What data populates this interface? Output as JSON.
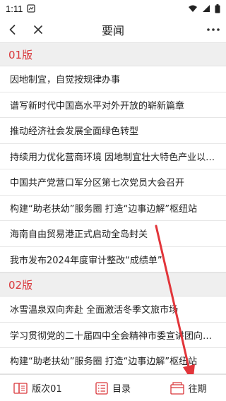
{
  "status_bar": {
    "time": "1:11"
  },
  "header": {
    "title": "要闻"
  },
  "sections": [
    {
      "label": "01版",
      "items": [
        "因地制宜，自觉按规律办事",
        "谱写新时代中国高水平对外开放的崭新篇章",
        "推动经济社会发展全面绿色转型",
        "持续用力优化营商环境 因地制宜壮大特色产业以实…",
        "中国共产党营口军分区第七次党员大会召开",
        "构建“助老扶幼”服务圈 打造“边事边解”枢纽站",
        "海南自由贸易港正式启动全岛封关",
        "我市发布2024年度审计整改“成绩单”"
      ]
    },
    {
      "label": "02版",
      "items": [
        "冰雪温泉双向奔赴 全面激活冬季文旅市场",
        "学习贯彻党的二十届四中全会精神市委宣讲团向新…",
        "构建“助老扶幼”服务圈 打造“边事边解”枢纽站"
      ]
    }
  ],
  "bottom_bar": {
    "edition_label": "版次01",
    "toc_label": "目录",
    "past_label": "往期"
  },
  "colors": {
    "accent": "#d9373b",
    "annotation_arrow": "#e2353a"
  },
  "icons": [
    "back-icon",
    "close-icon",
    "more-icon",
    "edition-icon",
    "toc-icon",
    "past-icon"
  ]
}
